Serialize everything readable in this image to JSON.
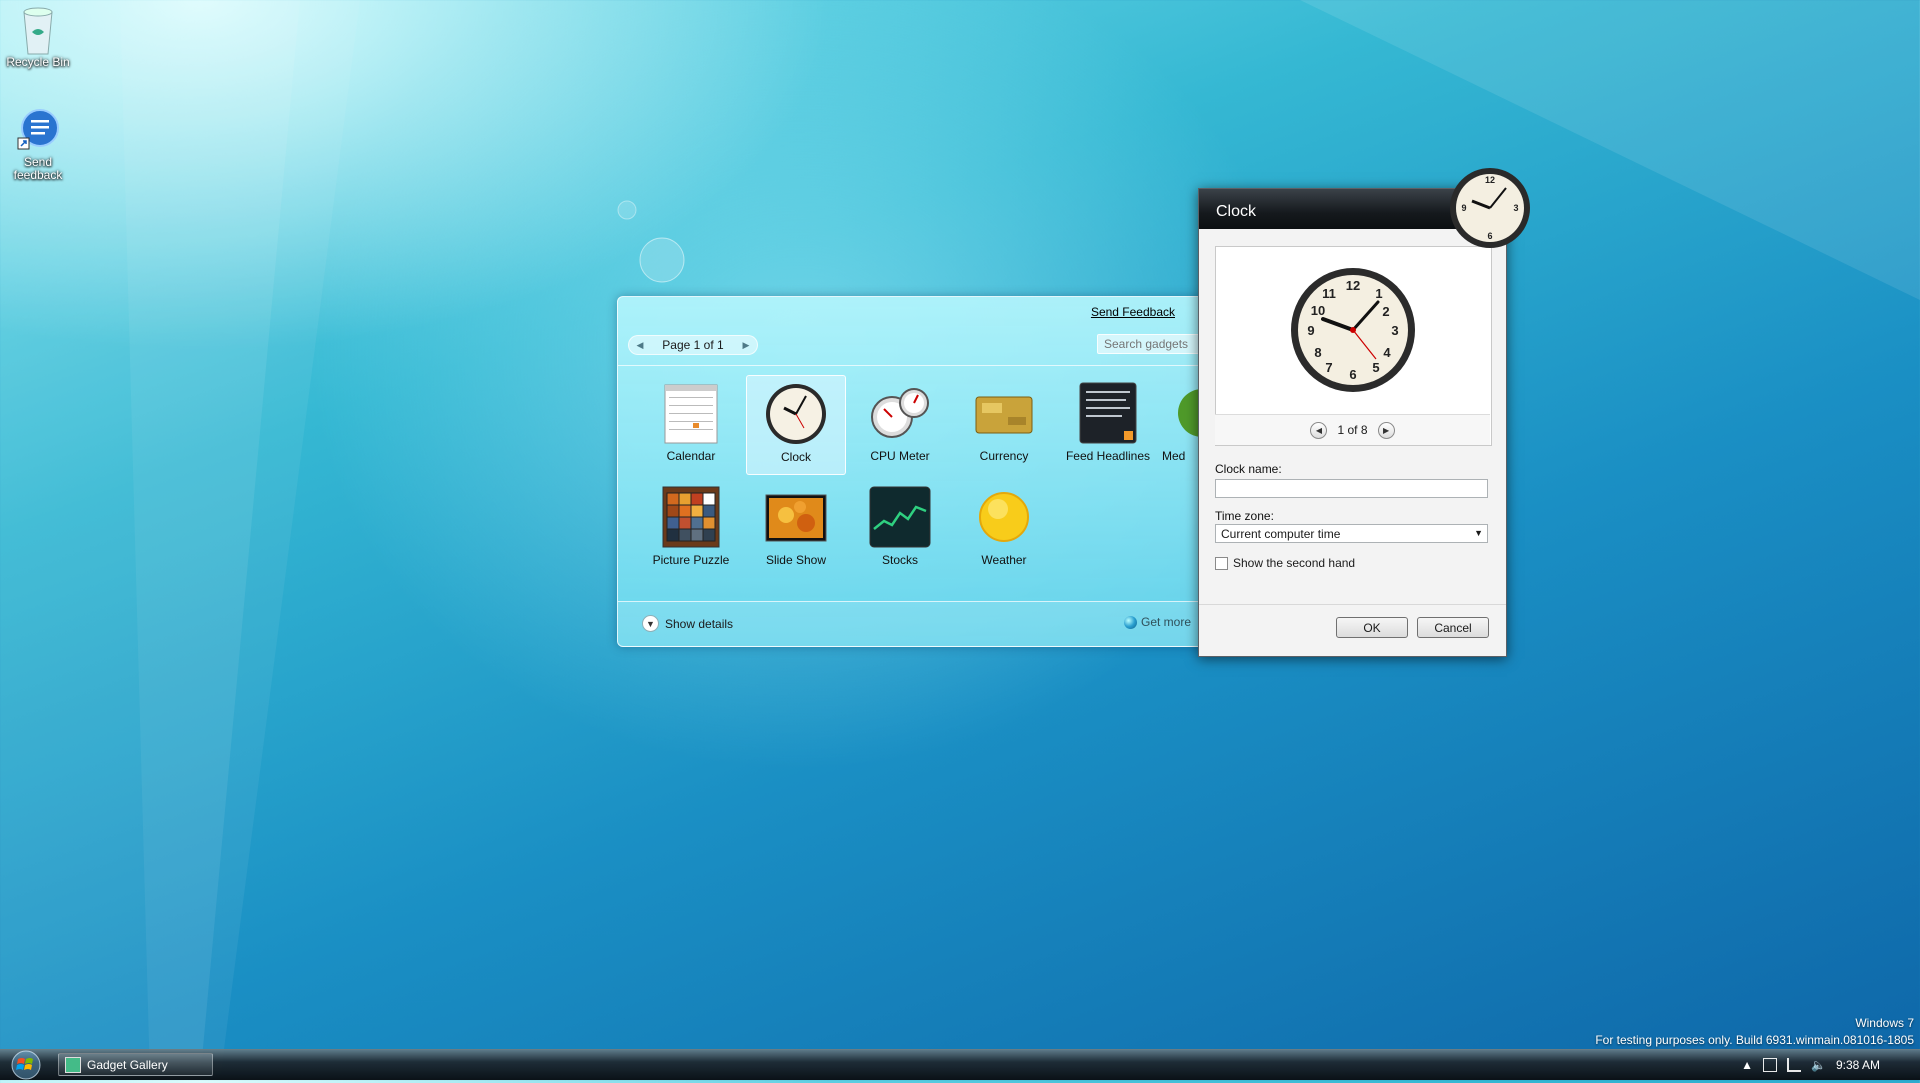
{
  "desktop": {
    "icons": [
      {
        "label": "Recycle Bin"
      },
      {
        "label": "Send feedback"
      }
    ],
    "watermark_line1": "Windows 7",
    "watermark_line2": "For testing purposes only. Build 6931.winmain.081016-1805"
  },
  "gallery": {
    "send_feedback": "Send Feedback",
    "page_label": "Page 1 of 1",
    "search_placeholder": "Search gadgets",
    "gadgets": [
      {
        "name": "Calendar",
        "icon": "calendar-icon"
      },
      {
        "name": "Clock",
        "icon": "clock-icon",
        "selected": true
      },
      {
        "name": "CPU Meter",
        "icon": "cpu-meter-icon"
      },
      {
        "name": "Currency",
        "icon": "currency-icon"
      },
      {
        "name": "Feed Headlines",
        "icon": "feed-headlines-icon"
      },
      {
        "name": "Med",
        "icon": "media-icon"
      },
      {
        "name": "Picture Puzzle",
        "icon": "picture-puzzle-icon"
      },
      {
        "name": "Slide Show",
        "icon": "slide-show-icon"
      },
      {
        "name": "Stocks",
        "icon": "stocks-icon"
      },
      {
        "name": "Weather",
        "icon": "weather-icon"
      }
    ],
    "show_details": "Show details",
    "get_more": "Get more"
  },
  "clock_dialog": {
    "title": "Clock",
    "preview_counter": "1 of 8",
    "clock_name_label": "Clock name:",
    "clock_name_value": "",
    "time_zone_label": "Time zone:",
    "time_zone_value": "Current computer time",
    "second_hand_label": "Show the second hand",
    "second_hand_checked": false,
    "ok_label": "OK",
    "cancel_label": "Cancel"
  },
  "taskbar": {
    "window_button": "Gadget Gallery",
    "clock": "9:38 AM"
  },
  "colors": {
    "desktop_blue": "#1a8fc4",
    "dialog_title": "#15191d",
    "gallery_bg": "#6edcf0"
  }
}
